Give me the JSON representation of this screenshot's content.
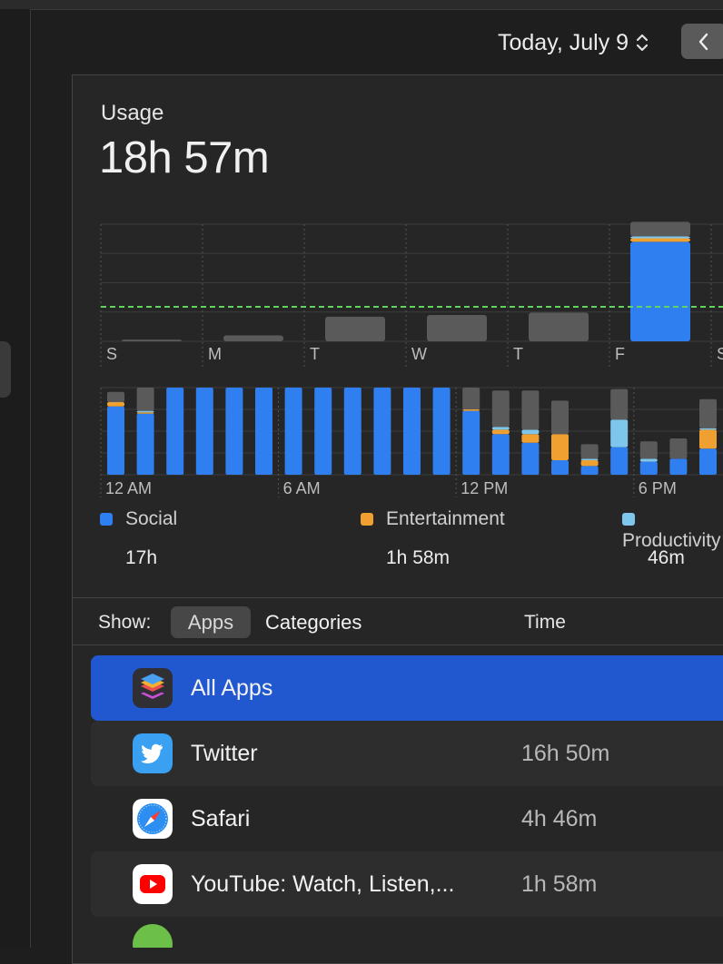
{
  "header": {
    "date_label": "Today, July 9"
  },
  "summary": {
    "label": "Usage",
    "total": "18h 57m"
  },
  "chart_data": [
    {
      "type": "bar",
      "title": "",
      "categories": [
        "S",
        "M",
        "T",
        "W",
        "T",
        "F",
        "S"
      ],
      "series": [
        {
          "name": "Social",
          "values": [
            0,
            0,
            0,
            0,
            0,
            17,
            0
          ]
        },
        {
          "name": "Entertainment",
          "values": [
            0,
            0,
            0,
            0,
            0,
            0.6,
            0
          ]
        },
        {
          "name": "Productivity",
          "values": [
            0,
            0,
            0,
            0,
            0,
            0.3,
            0
          ]
        },
        {
          "name": "Other",
          "values": [
            0.3,
            1.0,
            4.2,
            4.5,
            4.9,
            2.5,
            0
          ]
        }
      ],
      "average_line": true,
      "grid": true
    },
    {
      "type": "bar",
      "categories": [
        "12 AM",
        "1 AM",
        "2 AM",
        "3 AM",
        "4 AM",
        "5 AM",
        "6 AM",
        "7 AM",
        "8 AM",
        "9 AM",
        "10 AM",
        "11 AM",
        "12 PM",
        "1 PM",
        "2 PM",
        "3 PM",
        "4 PM",
        "5 PM",
        "6 PM",
        "7 PM",
        "8 PM"
      ],
      "x_tick_labels": [
        "12 AM",
        "6 AM",
        "12 PM",
        "6 PM"
      ],
      "series": [
        {
          "name": "Social",
          "values": [
            47,
            42,
            60,
            60,
            60,
            60,
            60,
            60,
            60,
            60,
            60,
            60,
            44,
            28,
            22,
            10,
            6,
            19,
            9,
            11,
            18
          ]
        },
        {
          "name": "Entertainment",
          "values": [
            3,
            1,
            0,
            0,
            0,
            0,
            0,
            0,
            0,
            0,
            0,
            0,
            1,
            3,
            6,
            18,
            4,
            0,
            0,
            0,
            13
          ]
        },
        {
          "name": "Productivity",
          "values": [
            0,
            1,
            0,
            0,
            0,
            0,
            0,
            0,
            0,
            0,
            0,
            0,
            0,
            2,
            3,
            0,
            1,
            19,
            2,
            0,
            1
          ]
        },
        {
          "name": "Other",
          "values": [
            7,
            16,
            0,
            0,
            0,
            0,
            0,
            0,
            0,
            0,
            0,
            0,
            15,
            25,
            27,
            23,
            10,
            21,
            12,
            14,
            20
          ]
        }
      ],
      "ylim": [
        0,
        60
      ],
      "grid": true
    }
  ],
  "legend": [
    {
      "name": "Social",
      "value": "17h",
      "color": "#2f7ff0"
    },
    {
      "name": "Entertainment",
      "value": "1h 58m",
      "color": "#f0a030"
    },
    {
      "name": "Productivity",
      "value": "46m",
      "color": "#7ec6ec"
    }
  ],
  "colors": {
    "social": "#2f7ff0",
    "entertainment": "#f0a030",
    "productivity": "#7ec6ec",
    "other": "#5a5a5a",
    "average_line": "#5ed65e",
    "selection": "#2158cf"
  },
  "controls": {
    "show_label": "Show:",
    "apps_tab": "Apps",
    "categories_tab": "Categories",
    "time_header": "Time"
  },
  "apps": [
    {
      "name": "All Apps",
      "time": "",
      "icon": "stack-icon"
    },
    {
      "name": "Twitter",
      "time": "16h 50m",
      "icon": "twitter-icon"
    },
    {
      "name": "Safari",
      "time": "4h 46m",
      "icon": "safari-icon"
    },
    {
      "name": "YouTube: Watch, Listen,...",
      "time": "1h 58m",
      "icon": "youtube-icon"
    }
  ]
}
